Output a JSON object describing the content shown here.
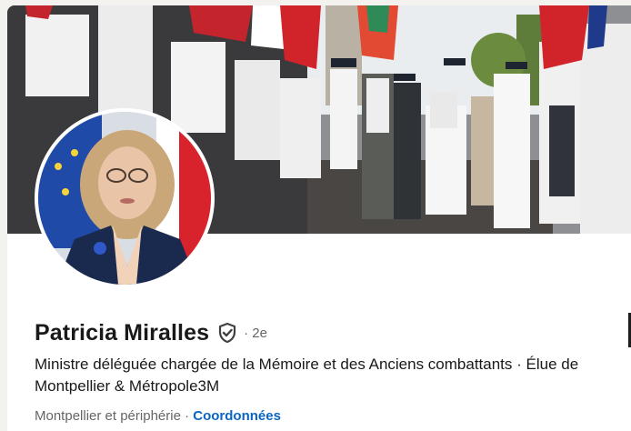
{
  "profile": {
    "name": "Patricia Miralles",
    "verified_icon": "verified-shield-icon",
    "connection_degree": "· 2e",
    "headline": "Ministre déléguée chargée de la Mémoire et des Anciens combattants · Élue de Montpellier & Métropole3M",
    "location": "Montpellier et périphérie",
    "separator": " · ",
    "contact_link": "Coordonnées"
  },
  "colors": {
    "link": "#0a66c2",
    "text_primary": "#191919",
    "text_secondary": "#666666",
    "background": "#f4f2ee"
  }
}
